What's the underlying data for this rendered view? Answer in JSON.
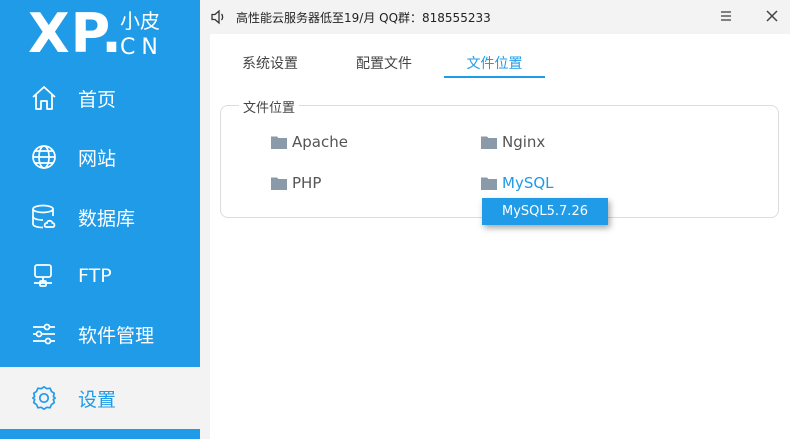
{
  "logo": {
    "main": "XP.",
    "cn": "小皮",
    "domain": "CN"
  },
  "sidebar": {
    "items": [
      {
        "label": "首页",
        "icon": "home-icon"
      },
      {
        "label": "网站",
        "icon": "globe-icon"
      },
      {
        "label": "数据库",
        "icon": "database-icon"
      },
      {
        "label": "FTP",
        "icon": "server-icon"
      },
      {
        "label": "软件管理",
        "icon": "sliders-icon"
      },
      {
        "label": "设置",
        "icon": "gear-icon"
      }
    ],
    "active": "设置"
  },
  "topbar": {
    "notice": "高性能云服务器低至19/月  QQ群：818555233",
    "speaker_icon": "speaker-icon",
    "minimize_icon": "minimize-icon",
    "close_icon": "close-icon"
  },
  "tabs": [
    {
      "label": "系统设置"
    },
    {
      "label": "配置文件"
    },
    {
      "label": "文件位置"
    }
  ],
  "active_tab": "文件位置",
  "file_location": {
    "title": "文件位置",
    "folders": [
      {
        "label": "Apache"
      },
      {
        "label": "Nginx"
      },
      {
        "label": "PHP"
      },
      {
        "label": "MySQL"
      }
    ],
    "dropdown": {
      "item": "MySQL5.7.26"
    }
  },
  "colors": {
    "accent": "#1f9be8",
    "background": "#f3f3f3",
    "folder": "#8a9aa8"
  }
}
